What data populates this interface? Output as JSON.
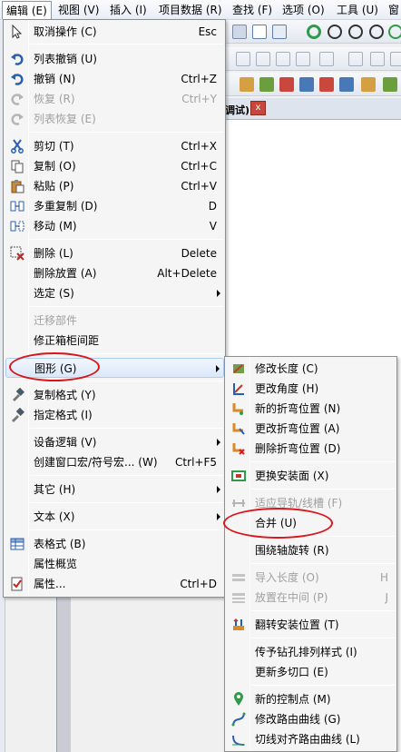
{
  "menubar": {
    "items": [
      {
        "label": "编辑 (E)"
      },
      {
        "label": "视图 (V)"
      },
      {
        "label": "插入 (I)"
      },
      {
        "label": "项目数据 (R)"
      },
      {
        "label": "查找 (F)"
      },
      {
        "label": "选项 (O)"
      },
      {
        "label": "工具 (U)"
      },
      {
        "label": "窗"
      }
    ]
  },
  "tab": {
    "title_fragment": "调试)",
    "close_glyph": "x"
  },
  "edit_menu": {
    "items": [
      {
        "label": "取消操作 (C)",
        "shortcut": "Esc",
        "icon": "cursor-icon"
      },
      {
        "label": "列表撤销 (U)",
        "shortcut": "",
        "icon": "undo-list-icon"
      },
      {
        "label": "撤销 (N)",
        "shortcut": "Ctrl+Z",
        "icon": "undo-icon"
      },
      {
        "label": "恢复 (R)",
        "shortcut": "Ctrl+Y",
        "icon": "redo-icon",
        "disabled": true
      },
      {
        "label": "列表恢复 (E)",
        "shortcut": "",
        "icon": "redo-list-icon",
        "disabled": true
      },
      {
        "label": "剪切 (T)",
        "shortcut": "Ctrl+X",
        "icon": "scissors-icon"
      },
      {
        "label": "复制 (O)",
        "shortcut": "Ctrl+C",
        "icon": "copy-icon"
      },
      {
        "label": "粘贴 (P)",
        "shortcut": "Ctrl+V",
        "icon": "paste-icon"
      },
      {
        "label": "多重复制 (D)",
        "shortcut": "D",
        "icon": "multi-copy-icon"
      },
      {
        "label": "移动 (M)",
        "shortcut": "V",
        "icon": "move-icon"
      },
      {
        "label": "删除 (L)",
        "shortcut": "Delete",
        "icon": "delete-icon"
      },
      {
        "label": "删除放置 (A)",
        "shortcut": "Alt+Delete",
        "icon": ""
      },
      {
        "label": "选定 (S)",
        "shortcut": "",
        "icon": "",
        "submenu": true
      },
      {
        "label": "迁移部件",
        "shortcut": "",
        "icon": "",
        "disabled": true
      },
      {
        "label": "修正箱柜间距",
        "shortcut": "",
        "icon": ""
      },
      {
        "label": "图形 (G)",
        "shortcut": "",
        "icon": "",
        "submenu": true,
        "highlight": true
      },
      {
        "label": "复制格式 (Y)",
        "shortcut": "",
        "icon": "format-brush-icon"
      },
      {
        "label": "指定格式 (I)",
        "shortcut": "",
        "icon": "apply-format-icon"
      },
      {
        "label": "设备逻辑 (V)",
        "shortcut": "",
        "icon": "",
        "submenu": true
      },
      {
        "label": "创建窗口宏/符号宏... (W)",
        "shortcut": "Ctrl+F5",
        "icon": ""
      },
      {
        "label": "其它 (H)",
        "shortcut": "",
        "icon": "",
        "submenu": true
      },
      {
        "label": "文本 (X)",
        "shortcut": "",
        "icon": "",
        "submenu": true
      },
      {
        "label": "表格式 (B)",
        "shortcut": "",
        "icon": "table-icon"
      },
      {
        "label": "属性概览",
        "shortcut": "",
        "icon": ""
      },
      {
        "label": "属性...",
        "shortcut": "Ctrl+D",
        "icon": "properties-icon"
      }
    ]
  },
  "graphics_menu": {
    "items": [
      {
        "label": "修改长度 (C)",
        "shortcut": "",
        "icon": "modify-length-icon"
      },
      {
        "label": "更改角度 (H)",
        "shortcut": "",
        "icon": "change-angle-icon"
      },
      {
        "label": "新的折弯位置 (N)",
        "shortcut": "",
        "icon": "new-bend-icon"
      },
      {
        "label": "更改折弯位置 (A)",
        "shortcut": "",
        "icon": "change-bend-icon"
      },
      {
        "label": "删除折弯位置 (D)",
        "shortcut": "",
        "icon": "delete-bend-icon"
      },
      {
        "label": "更换安装面 (X)",
        "shortcut": "",
        "icon": "change-mount-icon"
      },
      {
        "label": "适应导轨/线槽 (F)",
        "shortcut": "",
        "icon": "fit-rail-icon",
        "disabled": true
      },
      {
        "label": "合并 (U)",
        "shortcut": "",
        "icon": ""
      },
      {
        "label": "围绕轴旋转 (R)",
        "shortcut": "",
        "icon": ""
      },
      {
        "label": "导入长度 (O)",
        "shortcut": "H",
        "icon": "import-length-icon",
        "disabled": true
      },
      {
        "label": "放置在中间 (P)",
        "shortcut": "J",
        "icon": "center-icon",
        "disabled": true
      },
      {
        "label": "翻转安装位置 (T)",
        "shortcut": "",
        "icon": "flip-mount-icon"
      },
      {
        "label": "传予钻孔排列样式 (I)",
        "shortcut": "",
        "icon": ""
      },
      {
        "label": "更新多切口 (E)",
        "shortcut": "",
        "icon": ""
      },
      {
        "label": "新的控制点 (M)",
        "shortcut": "",
        "icon": "control-point-icon"
      },
      {
        "label": "修改路由曲线 (G)",
        "shortcut": "",
        "icon": "route-curve-icon"
      },
      {
        "label": "切线对齐路由曲线 (L)",
        "shortcut": "",
        "icon": "tangent-align-icon"
      }
    ]
  },
  "colors": {
    "annotation_red": "#d9141a",
    "highlight_border": "#aecdf2",
    "disabled_text": "#a0a0a0"
  }
}
